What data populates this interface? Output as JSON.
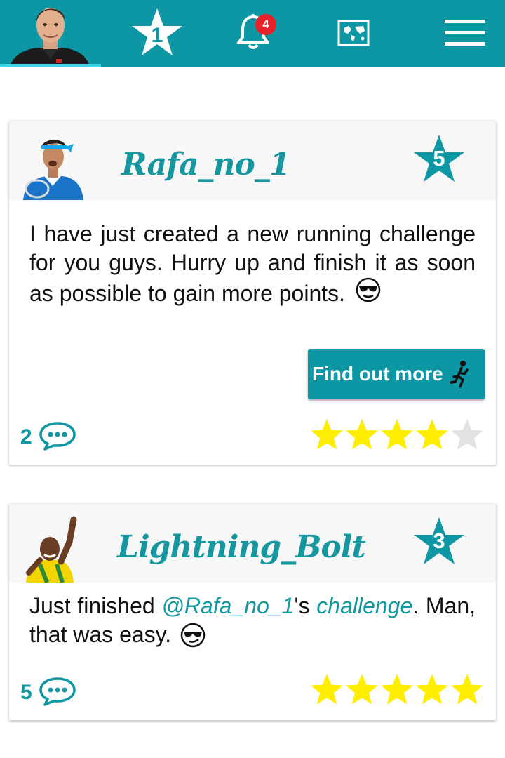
{
  "header": {
    "favorites_count": "1",
    "notifications_count": "4",
    "colors": {
      "bar": "#0d96a3",
      "active_tab": "#38d6e6",
      "badge": "#e8222b"
    },
    "icons": [
      "profile-avatar",
      "star-icon",
      "bell-icon",
      "map-icon",
      "hamburger-menu-icon"
    ]
  },
  "posts": [
    {
      "username": "Rafa_no_1",
      "level": "5",
      "text": "I have just created a new running challenge for you guys. Hurry up and finish it as soon as possible to gain more points.",
      "emoji": "sunglasses-emoji",
      "button_label": "Find out more",
      "comment_count": "2",
      "rating": 4,
      "rating_max": 5
    },
    {
      "username": "Lightning_Bolt",
      "level": "3",
      "text_before": "Just finished ",
      "mention": "@Rafa_no_1",
      "text_middle": "'s ",
      "link": "challenge",
      "text_after": ". Man, that was easy.",
      "emoji": "smirking-sunglasses-emoji",
      "comment_count": "5",
      "rating": 5,
      "rating_max": 5
    }
  ]
}
